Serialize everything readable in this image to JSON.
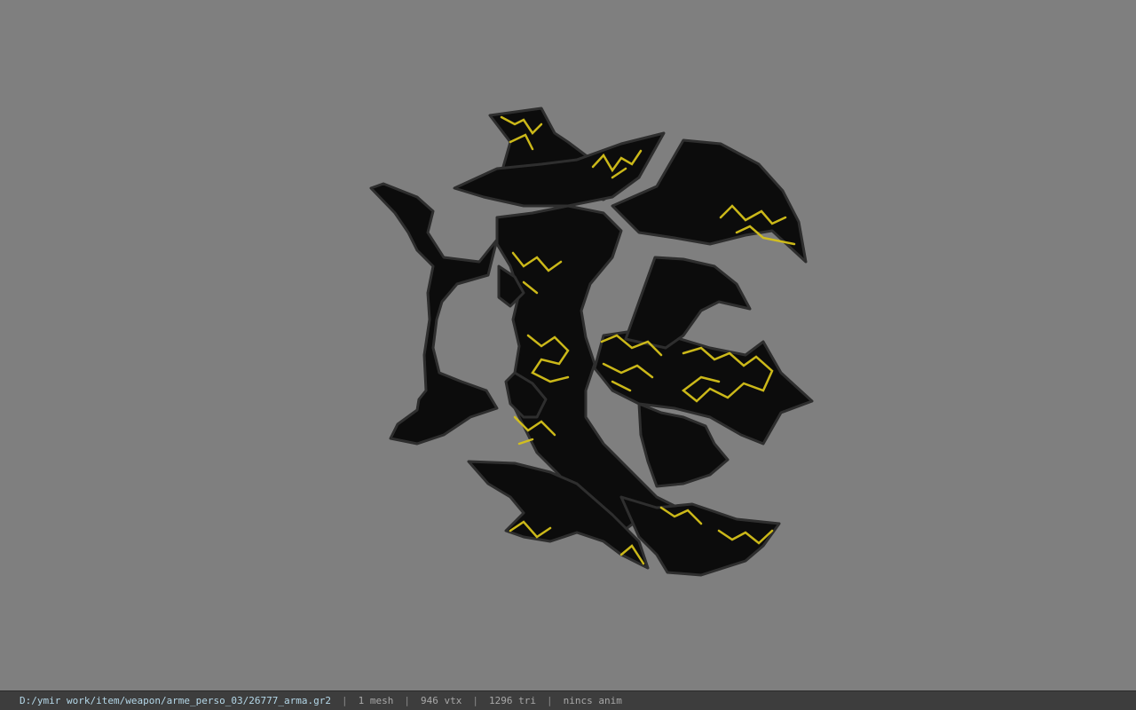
{
  "viewer": {
    "background_color": "#7f7f7f",
    "model_colors": {
      "body": "#0c0c0c",
      "edge": "#2e2e2e",
      "glow": "#d6c21a"
    }
  },
  "status": {
    "file_path": "D:/ymir work/item/weapon/arme_perso_03/26777_arma.gr2",
    "separator": "|",
    "mesh_count": "1 mesh",
    "vertex_count": "946 vtx",
    "triangle_count": "1296 tri",
    "anim_text": "nincs anim"
  }
}
